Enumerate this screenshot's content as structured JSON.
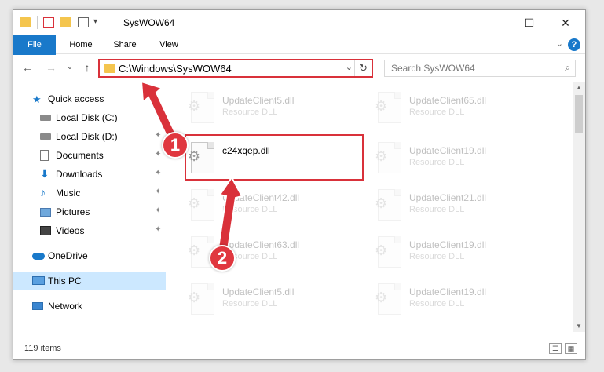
{
  "window": {
    "title": "SysWOW64",
    "minimize": "—",
    "maximize": "☐",
    "close": "✕"
  },
  "ribbon": {
    "tabs": [
      "File",
      "Home",
      "Share",
      "View"
    ],
    "help": "?",
    "expand": "⌄"
  },
  "nav": {
    "back": "←",
    "forward": "→",
    "recent": "⌄",
    "up": "↑",
    "address": "C:\\Windows\\SysWOW64",
    "address_dropdown": "⌄",
    "refresh": "↻",
    "search_placeholder": "Search SysWOW64",
    "search_icon": "⌕"
  },
  "sidebar": {
    "items": [
      {
        "label": "Quick access",
        "icon": "star-icon",
        "pinned": false
      },
      {
        "label": "Local Disk (C:)",
        "icon": "drive-icon",
        "pinned": true
      },
      {
        "label": "Local Disk (D:)",
        "icon": "drive-icon",
        "pinned": true
      },
      {
        "label": "Documents",
        "icon": "documents-icon",
        "pinned": true
      },
      {
        "label": "Downloads",
        "icon": "downloads-icon",
        "pinned": true
      },
      {
        "label": "Music",
        "icon": "music-icon",
        "pinned": true
      },
      {
        "label": "Pictures",
        "icon": "pictures-icon",
        "pinned": true
      },
      {
        "label": "Videos",
        "icon": "videos-icon",
        "pinned": true
      },
      {
        "label": "OneDrive",
        "icon": "cloud-icon",
        "pinned": false
      },
      {
        "label": "This PC",
        "icon": "computer-icon",
        "pinned": false,
        "selected": true
      },
      {
        "label": "Network",
        "icon": "network-icon",
        "pinned": false
      }
    ],
    "pin_glyph": "📌"
  },
  "files": {
    "left_col": [
      {
        "name": "UpdateClient5.dll",
        "type": "Resource DLL"
      },
      {
        "name": "c24xqep.dll",
        "type": ""
      },
      {
        "name": "UpdateClient42.dll",
        "type": "Resource DLL"
      },
      {
        "name": "UpdateClient63.dll",
        "type": "Resource DLL"
      },
      {
        "name": "UpdateClient5.dll",
        "type": "Resource DLL"
      }
    ],
    "right_col": [
      {
        "name": "UpdateClient65.dll",
        "type": "Resource DLL"
      },
      {
        "name": "UpdateClient19.dll",
        "type": "Resource DLL"
      },
      {
        "name": "UpdateClient21.dll",
        "type": "Resource DLL"
      },
      {
        "name": "UpdateClient19.dll",
        "type": "Resource DLL"
      },
      {
        "name": "UpdateClient19.dll",
        "type": "Resource DLL"
      }
    ],
    "gear_glyph": "⚙"
  },
  "status": {
    "count": "119 items",
    "details_view": "☰",
    "tiles_view": "▦"
  },
  "annotations": {
    "step1": "1",
    "step2": "2",
    "color": "#d9313a"
  }
}
